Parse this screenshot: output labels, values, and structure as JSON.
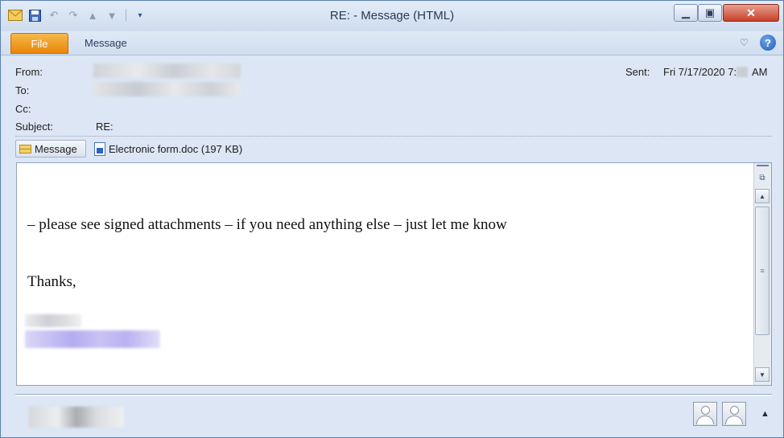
{
  "window": {
    "title": "RE:  - Message (HTML)"
  },
  "quick_access": {
    "icons": [
      "mail-icon",
      "save-icon",
      "undo-icon",
      "redo-icon",
      "previous-item-icon",
      "next-item-icon",
      "customize-toolbar-icon"
    ]
  },
  "ribbon": {
    "file_tab": "File",
    "message_tab": "Message",
    "help_label": "?"
  },
  "header": {
    "from_label": "From:",
    "to_label": "To:",
    "cc_label": "Cc:",
    "subject_label": "Subject:",
    "subject_value": "RE:",
    "sent_label": "Sent:",
    "sent_value_prefix": "Fri 7/17/2020 7:",
    "sent_value_suffix": " AM"
  },
  "attachments": {
    "message_label": "Message",
    "file_label": "Electronic form.doc (197 KB)"
  },
  "body": {
    "line1": "– please see signed attachments – if you need anything else – just let me know",
    "line2": "Thanks,"
  },
  "colors": {
    "file_tab": "#e9850a",
    "title_bar": "#d6e2f2",
    "close_button": "#c8402a"
  }
}
